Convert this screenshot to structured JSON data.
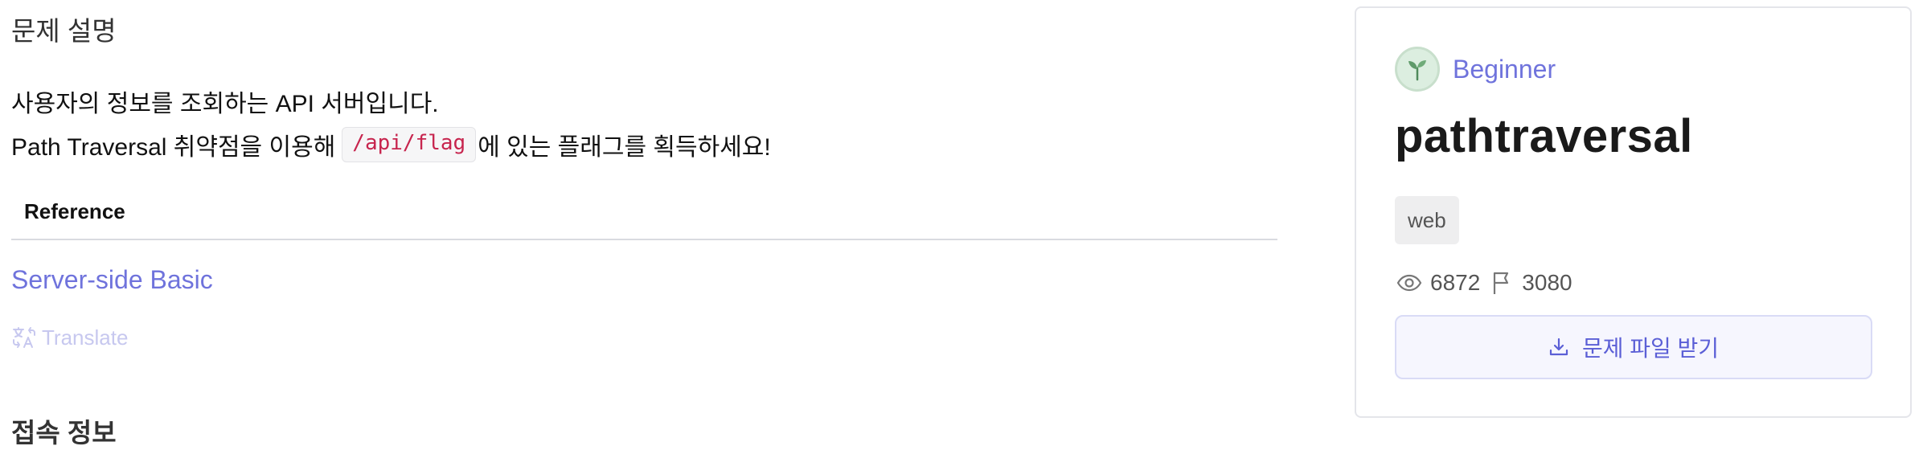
{
  "description": {
    "section_title": "문제 설명",
    "line1": "사용자의 정보를 조회하는 API 서버입니다.",
    "line2_before": "Path Traversal 취약점을 이용해",
    "line2_code": "/api/flag",
    "line2_after": "에 있는 플래그를 획득하세요!",
    "reference_header": "Reference",
    "reference_link": "Server-side Basic",
    "translate_label": "Translate",
    "next_section_title": "접속 정보"
  },
  "card": {
    "level": "Beginner",
    "title": "pathtraversal",
    "tag": "web",
    "views": "6872",
    "solves": "3080",
    "download_label": "문제 파일 받기"
  },
  "icons": {
    "level": "sprout-icon",
    "translate": "translate-icon",
    "views": "eye-icon",
    "solves": "flag-icon",
    "download": "download-icon"
  },
  "colors": {
    "accent": "#6f73dc",
    "code": "#c7254e",
    "translate": "#c7c8ef",
    "level_badge": "#dceee0"
  }
}
